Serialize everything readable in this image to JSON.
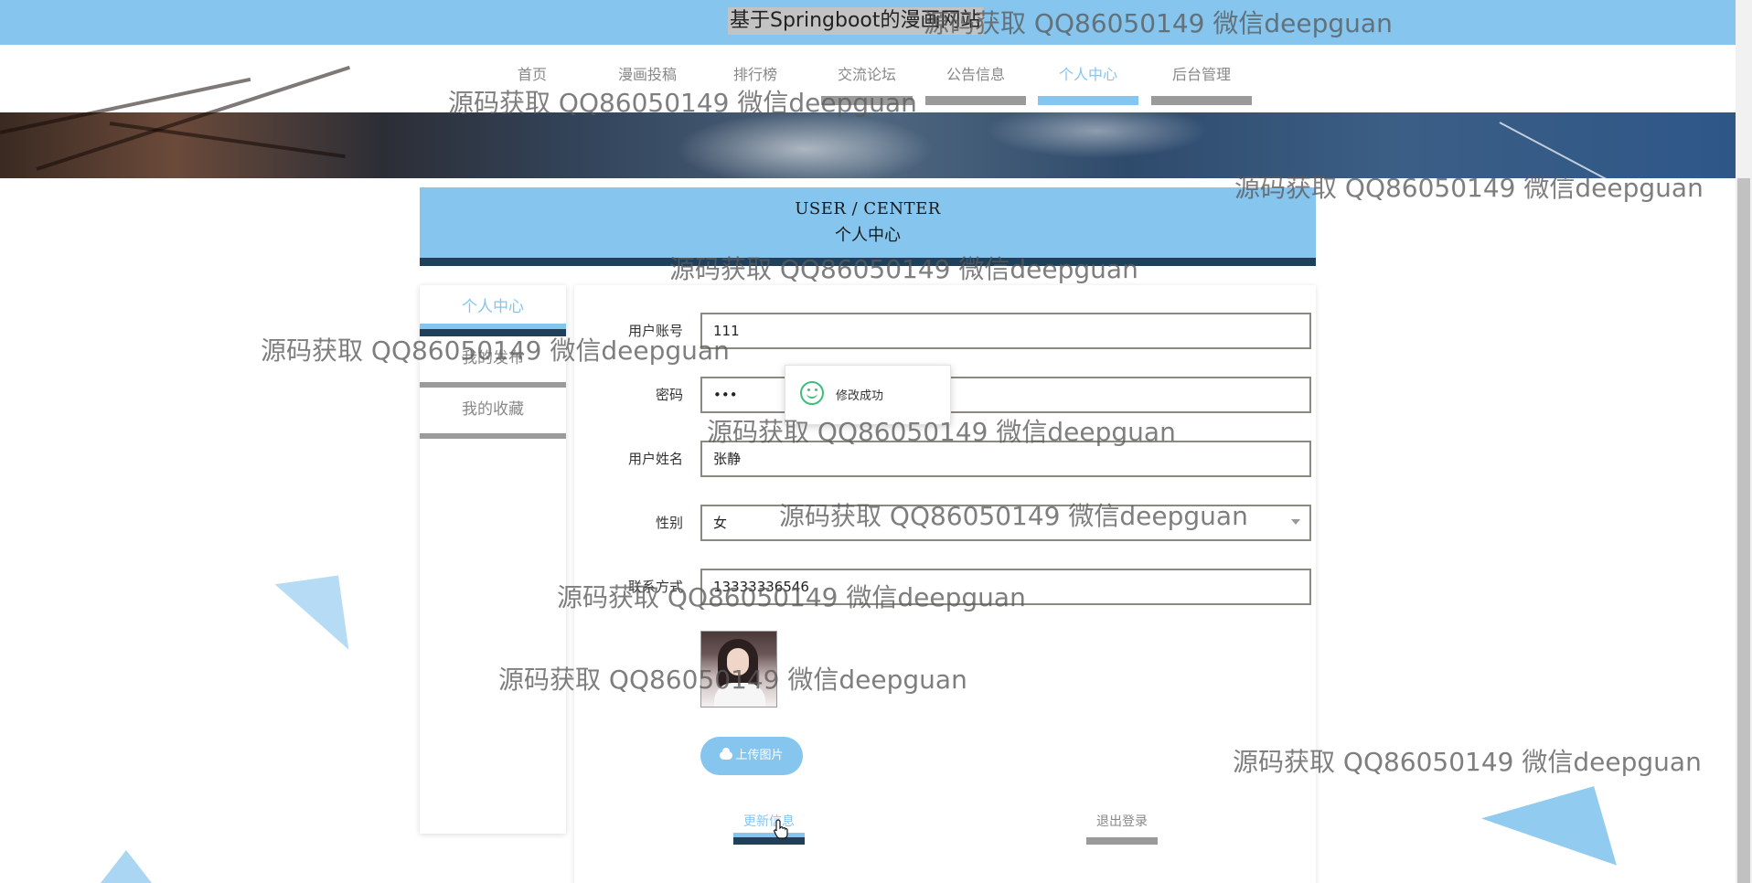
{
  "site": {
    "title": "基于Springboot的漫画网站"
  },
  "nav": {
    "items": [
      {
        "label": "首页"
      },
      {
        "label": "漫画投稿"
      },
      {
        "label": "排行榜"
      },
      {
        "label": "交流论坛"
      },
      {
        "label": "公告信息"
      },
      {
        "label": "个人中心",
        "active": true
      },
      {
        "label": "后台管理"
      }
    ]
  },
  "header": {
    "title_en": "USER / CENTER",
    "title_cn": "个人中心"
  },
  "sidemenu": {
    "items": [
      {
        "label": "个人中心",
        "active": true
      },
      {
        "label": "我的发布"
      },
      {
        "label": "我的收藏"
      }
    ]
  },
  "form": {
    "username": {
      "label": "用户账号",
      "value": "111"
    },
    "password": {
      "label": "密码",
      "value": "•••"
    },
    "realname": {
      "label": "用户姓名",
      "value": "张静"
    },
    "gender": {
      "label": "性别",
      "value": "女"
    },
    "phone": {
      "label": "联系方式",
      "value": "13333336546"
    },
    "upload_label": "上传图片",
    "update_label": "更新信息",
    "logout_label": "退出登录"
  },
  "toast": {
    "message": "修改成功"
  },
  "watermark": "源码获取 QQ86050149 微信deepguan",
  "colors": {
    "primary": "#86c5ee",
    "dark": "#1f3f5b",
    "gray": "#9a9a9a",
    "success": "#3cbf7c"
  }
}
